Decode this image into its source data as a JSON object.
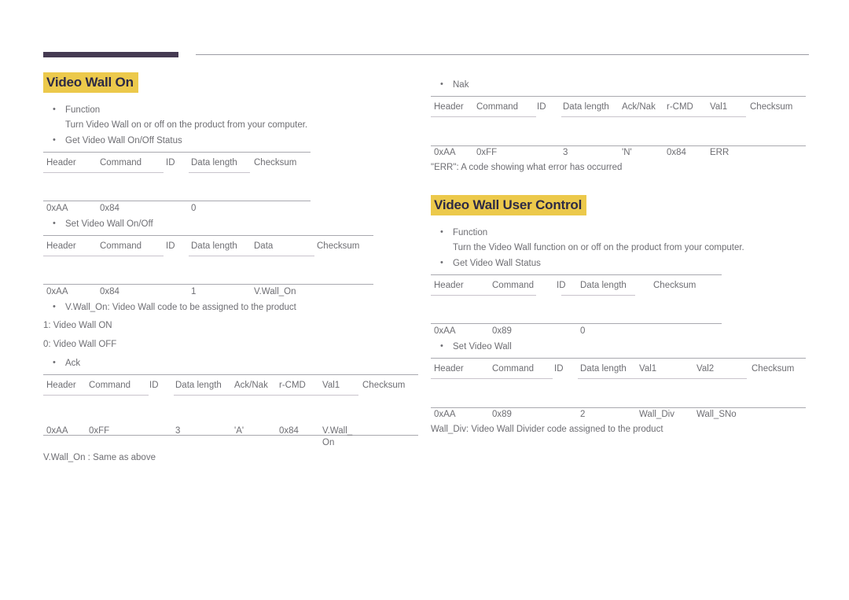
{
  "page": {
    "decoration": {
      "bar_color": "#453a52",
      "rule_color": "#9c9ca3",
      "highlight_color": "#ecc94b",
      "heading_text_color": "#2d2a45"
    }
  },
  "left_column": {
    "section_title": "Video Wall On",
    "function_bullet": {
      "label": "Function",
      "description": "Turn Video Wall on or off on the product from your computer."
    },
    "get_status": {
      "bullet": "Get Video Wall On/Off Status",
      "table": {
        "headers": [
          "Header",
          "Command",
          "ID",
          "Data length",
          "Checksum"
        ],
        "values": [
          "0xAA",
          "0x84",
          "",
          "0",
          ""
        ]
      }
    },
    "set_onoff": {
      "bullet": "Set Video Wall On/Off",
      "table": {
        "headers": [
          "Header",
          "Command",
          "ID",
          "Data length",
          "Data",
          "Checksum"
        ],
        "values": [
          "0xAA",
          "0x84",
          "",
          "1",
          "V.Wall_On",
          ""
        ]
      }
    },
    "code_bullet": "V.Wall_On: Video Wall code to be assigned to the product",
    "code_values": [
      "1: Video Wall ON",
      "0: Video Wall OFF"
    ],
    "ack": {
      "bullet": "Ack",
      "table": {
        "headers": [
          "Header",
          "Command",
          "ID",
          "Data length",
          "Ack/Nak",
          "r-CMD",
          "Val1",
          "Checksum"
        ],
        "values": [
          "0xAA",
          "0xFF",
          "",
          "3",
          "'A'",
          "0x84",
          "V.Wall_\nOn",
          ""
        ]
      }
    },
    "ack_note": "V.Wall_On : Same as above"
  },
  "right_column": {
    "nak": {
      "bullet": "Nak",
      "table": {
        "headers": [
          "Header",
          "Command",
          "ID",
          "Data length",
          "Ack/Nak",
          "r-CMD",
          "Val1",
          "Checksum"
        ],
        "values": [
          "0xAA",
          "0xFF",
          "",
          "3",
          "'N'",
          "0x84",
          "ERR",
          ""
        ]
      }
    },
    "nak_note": "\"ERR\": A code showing what error has occurred",
    "section_title": "Video Wall User Control",
    "function_bullet": {
      "label": "Function",
      "description": "Turn the Video Wall function on or off on the product from your computer."
    },
    "get_status": {
      "bullet": "Get Video Wall Status",
      "table": {
        "headers": [
          "Header",
          "Command",
          "ID",
          "Data length",
          "Checksum"
        ],
        "values": [
          "0xAA",
          "0x89",
          "",
          "0",
          ""
        ]
      }
    },
    "set_video_wall": {
      "bullet": "Set Video Wall",
      "table": {
        "headers": [
          "Header",
          "Command",
          "ID",
          "Data length",
          "Val1",
          "Val2",
          "Checksum"
        ],
        "values": [
          "0xAA",
          "0x89",
          "",
          "2",
          "Wall_Div",
          "Wall_SNo",
          ""
        ]
      }
    },
    "wall_div_note": "Wall_Div: Video Wall Divider code assigned to the product"
  }
}
